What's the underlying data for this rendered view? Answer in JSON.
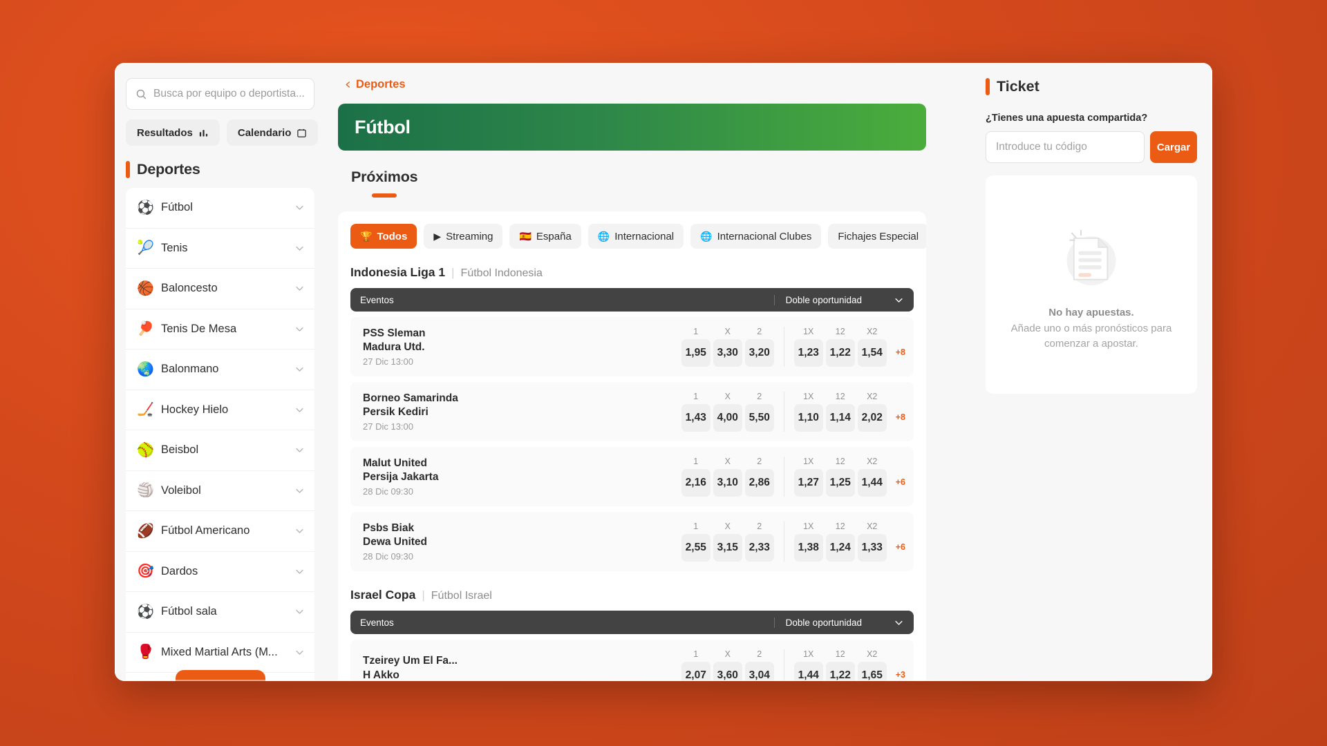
{
  "theme": {
    "accent": "#ec5b13",
    "banner_from": "#1c7048",
    "banner_to": "#4bad3c",
    "header_dark": "#434343"
  },
  "sidebar": {
    "search": {
      "placeholder": "Busca por equipo o deportista...",
      "value": "",
      "icon": "search-icon"
    },
    "buttons": [
      {
        "label": "Resultados",
        "icon": "bar-chart-icon"
      },
      {
        "label": "Calendario",
        "icon": "calendar-icon"
      }
    ],
    "section_title": "Deportes",
    "items": [
      {
        "label": "Fútbol",
        "emoji": "⚽"
      },
      {
        "label": "Tenis",
        "emoji": "🎾"
      },
      {
        "label": "Baloncesto",
        "emoji": "🏀"
      },
      {
        "label": "Tenis De Mesa",
        "emoji": "🏓"
      },
      {
        "label": "Balonmano",
        "emoji": "🌏"
      },
      {
        "label": "Hockey Hielo",
        "emoji": "🏒"
      },
      {
        "label": "Beisbol",
        "emoji": "🥎"
      },
      {
        "label": "Voleibol",
        "emoji": "🏐"
      },
      {
        "label": "Fútbol Americano",
        "emoji": "🏈"
      },
      {
        "label": "Dardos",
        "emoji": "🎯"
      },
      {
        "label": "Fútbol sala",
        "emoji": "⚽"
      },
      {
        "label": "Mixed Martial Arts (M...",
        "emoji": "🥊"
      }
    ]
  },
  "main": {
    "breadcrumb": "Deportes",
    "banner_title": "Fútbol",
    "section_label": "Próximos",
    "filters": [
      {
        "label": "Todos",
        "icon": "🏆",
        "active": true
      },
      {
        "label": "Streaming",
        "icon": "▶",
        "active": false
      },
      {
        "label": "España",
        "icon": "🇪🇸",
        "active": false
      },
      {
        "label": "Internacional",
        "icon": "🌐",
        "active": false
      },
      {
        "label": "Internacional Clubes",
        "icon": "🌐",
        "active": false
      },
      {
        "label": "Fichajes Especial",
        "icon": "",
        "active": false
      }
    ],
    "columns_main": [
      "1",
      "X",
      "2"
    ],
    "columns_double": [
      "1X",
      "12",
      "X2"
    ],
    "table_header": {
      "events": "Eventos",
      "market": "Doble oportunidad"
    },
    "leagues": [
      {
        "name": "Indonesia Liga 1",
        "sub": "Fútbol Indonesia",
        "events": [
          {
            "home": "PSS Sleman",
            "away": "Madura Utd.",
            "datetime": "27 Dic 13:00",
            "odds_main": [
              "1,95",
              "3,30",
              "3,20"
            ],
            "odds_double": [
              "1,23",
              "1,22",
              "1,54"
            ],
            "more": "+8"
          },
          {
            "home": "Borneo Samarinda",
            "away": "Persik Kediri",
            "datetime": "27 Dic 13:00",
            "odds_main": [
              "1,43",
              "4,00",
              "5,50"
            ],
            "odds_double": [
              "1,10",
              "1,14",
              "2,02"
            ],
            "more": "+8"
          },
          {
            "home": "Malut United",
            "away": "Persija Jakarta",
            "datetime": "28 Dic 09:30",
            "odds_main": [
              "2,16",
              "3,10",
              "2,86"
            ],
            "odds_double": [
              "1,27",
              "1,25",
              "1,44"
            ],
            "more": "+6"
          },
          {
            "home": "Psbs Biak",
            "away": "Dewa United",
            "datetime": "28 Dic 09:30",
            "odds_main": [
              "2,55",
              "3,15",
              "2,33"
            ],
            "odds_double": [
              "1,38",
              "1,24",
              "1,33"
            ],
            "more": "+6"
          }
        ]
      },
      {
        "name": "Israel Copa",
        "sub": "Fútbol Israel",
        "events": [
          {
            "home": "Tzeirey Um El Fa...",
            "away": "H Akko",
            "datetime": "",
            "odds_main": [
              "2,07",
              "3,60",
              "3,04"
            ],
            "odds_double": [
              "1,44",
              "1,22",
              "1,65"
            ],
            "more": "+3"
          }
        ]
      }
    ]
  },
  "ticket": {
    "title": "Ticket",
    "shared_question": "¿Tienes una apuesta compartida?",
    "code_placeholder": "Introduce tu código",
    "code_value": "",
    "load_label": "Cargar",
    "empty_title": "No hay apuestas.",
    "empty_sub": "Añade uno o más pronósticos para comenzar a apostar."
  }
}
